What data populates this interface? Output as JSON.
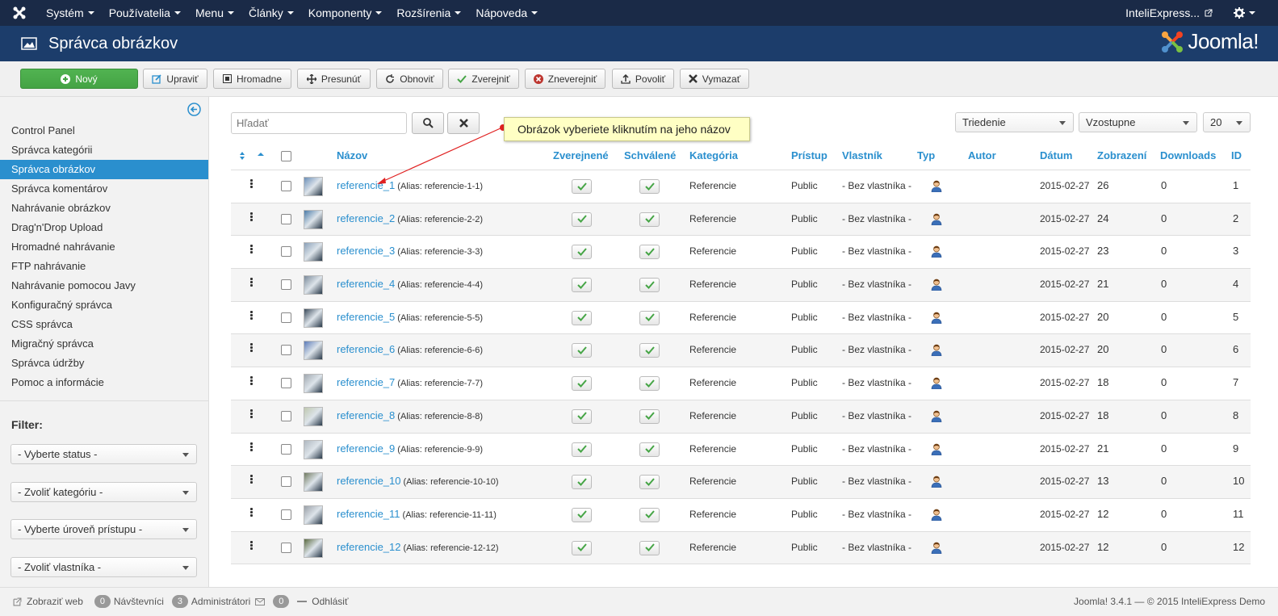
{
  "navbar": {
    "menu": [
      "Systém",
      "Používatelia",
      "Menu",
      "Články",
      "Komponenty",
      "Rozšírenia",
      "Nápoveda"
    ],
    "site_link": "InteliExpress..."
  },
  "header": {
    "title": "Správca obrázkov",
    "brand": "Joomla!"
  },
  "toolbar": {
    "new": "Nový",
    "edit": "Upraviť",
    "batch": "Hromadne",
    "move": "Presunúť",
    "refresh": "Obnoviť",
    "publish": "Zverejniť",
    "unpublish": "Zneverejniť",
    "approve": "Povoliť",
    "delete": "Vymazať"
  },
  "sidebar": {
    "items": [
      "Control Panel",
      "Správca kategórii",
      "Správca obrázkov",
      "Správca komentárov",
      "Nahrávanie obrázkov",
      "Drag'n'Drop Upload",
      "Hromadné nahrávanie",
      "FTP nahrávanie",
      "Nahrávanie pomocou Javy",
      "Konfiguračný správca",
      "CSS správca",
      "Migračný správca",
      "Správca údržby",
      "Pomoc a informácie"
    ],
    "active_index": 2,
    "filter_label": "Filter:",
    "filters": [
      "- Vyberte status -",
      "- Zvoliť kategóriu -",
      "- Vyberte úroveň prístupu -",
      "- Zvoliť vlastníka -"
    ]
  },
  "search": {
    "placeholder": "Hľadať"
  },
  "sorting": {
    "order_by": "Triedenie",
    "direction": "Vzostupne",
    "limit": "20"
  },
  "tooltip": "Obrázok vyberiete kliknutím na jeho názov",
  "table": {
    "headers": {
      "title": "Názov",
      "published": "Zverejnené",
      "approved": "Schválené",
      "category": "Kategória",
      "access": "Prístup",
      "owner": "Vlastník",
      "type": "Typ",
      "author": "Autor",
      "date": "Dátum",
      "hits": "Zobrazení",
      "downloads": "Downloads",
      "id": "ID"
    },
    "rows": [
      {
        "title": "referencie_1",
        "alias": "(Alias: referencie-1-1)",
        "category": "Referencie",
        "access": "Public",
        "owner": "- Bez vlastníka -",
        "date": "2015-02-27",
        "hits": "26",
        "downloads": "0",
        "id": "1"
      },
      {
        "title": "referencie_2",
        "alias": "(Alias: referencie-2-2)",
        "category": "Referencie",
        "access": "Public",
        "owner": "- Bez vlastníka -",
        "date": "2015-02-27",
        "hits": "24",
        "downloads": "0",
        "id": "2"
      },
      {
        "title": "referencie_3",
        "alias": "(Alias: referencie-3-3)",
        "category": "Referencie",
        "access": "Public",
        "owner": "- Bez vlastníka -",
        "date": "2015-02-27",
        "hits": "23",
        "downloads": "0",
        "id": "3"
      },
      {
        "title": "referencie_4",
        "alias": "(Alias: referencie-4-4)",
        "category": "Referencie",
        "access": "Public",
        "owner": "- Bez vlastníka -",
        "date": "2015-02-27",
        "hits": "21",
        "downloads": "0",
        "id": "4"
      },
      {
        "title": "referencie_5",
        "alias": "(Alias: referencie-5-5)",
        "category": "Referencie",
        "access": "Public",
        "owner": "- Bez vlastníka -",
        "date": "2015-02-27",
        "hits": "20",
        "downloads": "0",
        "id": "5"
      },
      {
        "title": "referencie_6",
        "alias": "(Alias: referencie-6-6)",
        "category": "Referencie",
        "access": "Public",
        "owner": "- Bez vlastníka -",
        "date": "2015-02-27",
        "hits": "20",
        "downloads": "0",
        "id": "6"
      },
      {
        "title": "referencie_7",
        "alias": "(Alias: referencie-7-7)",
        "category": "Referencie",
        "access": "Public",
        "owner": "- Bez vlastníka -",
        "date": "2015-02-27",
        "hits": "18",
        "downloads": "0",
        "id": "7"
      },
      {
        "title": "referencie_8",
        "alias": "(Alias: referencie-8-8)",
        "category": "Referencie",
        "access": "Public",
        "owner": "- Bez vlastníka -",
        "date": "2015-02-27",
        "hits": "18",
        "downloads": "0",
        "id": "8"
      },
      {
        "title": "referencie_9",
        "alias": "(Alias: referencie-9-9)",
        "category": "Referencie",
        "access": "Public",
        "owner": "- Bez vlastníka -",
        "date": "2015-02-27",
        "hits": "21",
        "downloads": "0",
        "id": "9"
      },
      {
        "title": "referencie_10",
        "alias": "(Alias: referencie-10-10)",
        "category": "Referencie",
        "access": "Public",
        "owner": "- Bez vlastníka -",
        "date": "2015-02-27",
        "hits": "13",
        "downloads": "0",
        "id": "10"
      },
      {
        "title": "referencie_11",
        "alias": "(Alias: referencie-11-11)",
        "category": "Referencie",
        "access": "Public",
        "owner": "- Bez vlastníka -",
        "date": "2015-02-27",
        "hits": "12",
        "downloads": "0",
        "id": "11"
      },
      {
        "title": "referencie_12",
        "alias": "(Alias: referencie-12-12)",
        "category": "Referencie",
        "access": "Public",
        "owner": "- Bez vlastníka -",
        "date": "2015-02-27",
        "hits": "12",
        "downloads": "0",
        "id": "12"
      }
    ]
  },
  "footer": {
    "view_site": "Zobraziť web",
    "visitors_count": "0",
    "visitors_label": "Návštevníci",
    "admins_count": "3",
    "admins_label": "Administrátori",
    "messages_count": "0",
    "logout": "Odhlásiť",
    "version": "Joomla! 3.4.1 — © 2015 InteliExpress Demo"
  }
}
